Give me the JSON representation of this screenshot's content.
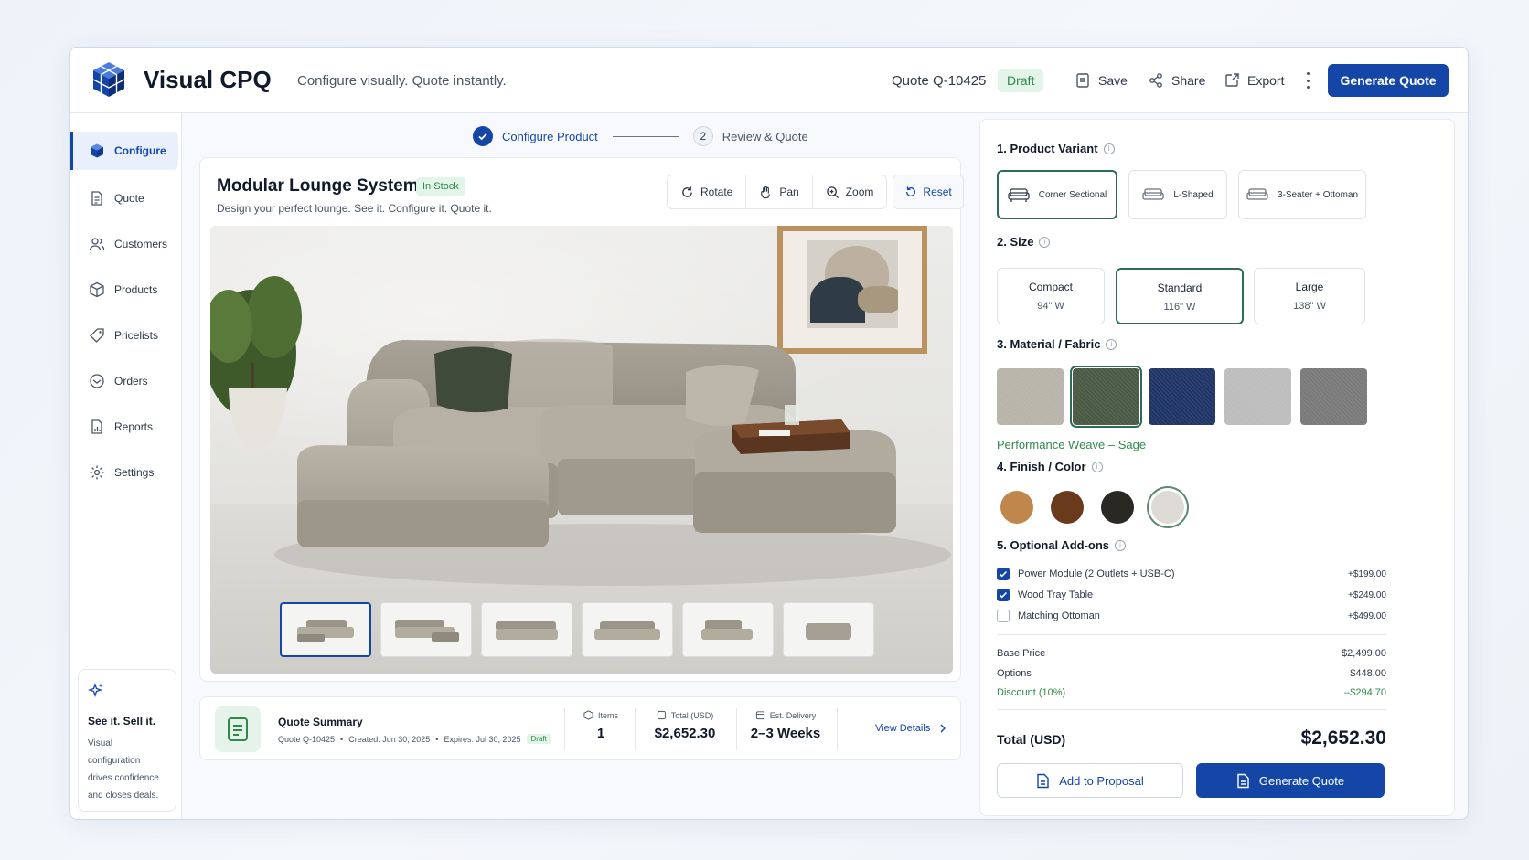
{
  "header": {
    "app_title": "Visual CPQ",
    "tagline": "Configure visually. Quote instantly.",
    "quote_id": "Quote Q-10425",
    "status": "Draft",
    "save": "Save",
    "share": "Share",
    "export": "Export",
    "generate": "Generate Quote"
  },
  "sidebar": {
    "items": [
      {
        "label": "Configure",
        "icon": "cube-icon",
        "active": true
      },
      {
        "label": "Quote",
        "icon": "document-icon"
      },
      {
        "label": "Customers",
        "icon": "users-icon"
      },
      {
        "label": "Products",
        "icon": "box-icon"
      },
      {
        "label": "Pricelists",
        "icon": "tag-icon"
      },
      {
        "label": "Orders",
        "icon": "orders-icon"
      },
      {
        "label": "Reports",
        "icon": "report-icon"
      },
      {
        "label": "Settings",
        "icon": "gear-icon"
      }
    ],
    "promo": {
      "title": "See it. Sell it.",
      "text": "Visual configuration drives confidence and closes deals."
    }
  },
  "stepper": {
    "step1": "Configure Product",
    "step2_num": "2",
    "step2": "Review & Quote"
  },
  "product": {
    "title": "Modular Lounge System",
    "stock": "In Stock",
    "subtitle": "Design your perfect lounge. See it. Configure it. Quote it.",
    "tools": {
      "rotate": "Rotate",
      "pan": "Pan",
      "zoom": "Zoom",
      "reset": "Reset"
    },
    "thumbnail_count": 6,
    "active_thumbnail": 1
  },
  "summary": {
    "title": "Quote Summary",
    "quote": "Quote Q-10425",
    "created": "Created: Jun 30, 2025",
    "expires": "Expires: Jul 30, 2025",
    "status": "Draft",
    "items_label": "Items",
    "items_value": "1",
    "total_label": "Total (USD)",
    "total_value": "$2,652.30",
    "delivery_label": "Est. Delivery",
    "delivery_value": "2–3 Weeks",
    "view_details": "View Details"
  },
  "config": {
    "variant_heading": "1. Product Variant",
    "variants": [
      {
        "label": "Corner Sectional",
        "selected": true
      },
      {
        "label": "L-Shaped"
      },
      {
        "label": "3-Seater + Ottoman"
      }
    ],
    "size_heading": "2. Size",
    "sizes": [
      {
        "name": "Compact",
        "dim": "94\" W"
      },
      {
        "name": "Standard",
        "dim": "116\" W",
        "selected": true
      },
      {
        "name": "Large",
        "dim": "138\" W"
      }
    ],
    "material_heading": "3. Material / Fabric",
    "swatches": [
      "#b9b4aa",
      "#4a5a44",
      "#1f3566",
      "#bdbdbd",
      "#7a7a7a"
    ],
    "selected_swatch": 1,
    "fabric_name": "Performance Weave – Sage",
    "finish_heading": "4. Finish / Color",
    "finishes": [
      "#c0874c",
      "#6a3a1d",
      "#2a2823",
      "#dedbd5"
    ],
    "selected_finish": 3,
    "addons_heading": "5. Optional Add-ons",
    "addons": [
      {
        "label": "Power Module (2 Outlets + USB-C)",
        "price": "+$199.00",
        "checked": true
      },
      {
        "label": "Wood Tray Table",
        "price": "+$249.00",
        "checked": true
      },
      {
        "label": "Matching Ottoman",
        "price": "+$499.00",
        "checked": false
      }
    ],
    "pricing": {
      "base_label": "Base Price",
      "base": "$2,499.00",
      "options_label": "Options",
      "options": "$448.00",
      "discount_label": "Discount (10%)",
      "discount": "–$294.70",
      "total_label": "Total (USD)",
      "total": "$2,652.30"
    },
    "add_to_proposal": "Add to Proposal",
    "generate": "Generate Quote"
  },
  "colors": {
    "accent": "#1446a8",
    "success": "#2f8a4a",
    "selected_border": "#2f6b55"
  }
}
